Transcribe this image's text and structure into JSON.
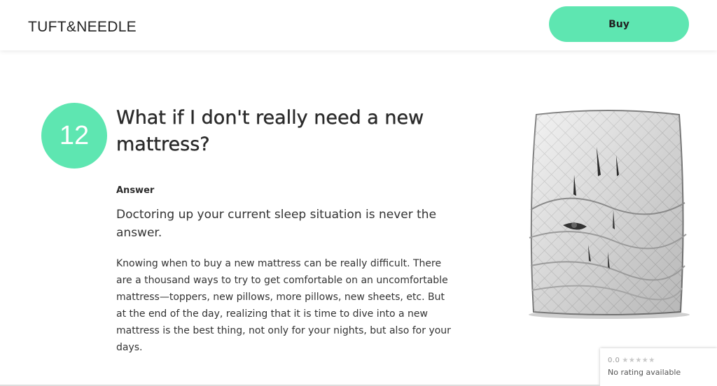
{
  "header": {
    "logo": "TUFT&NEEDLE",
    "buy_label": "Buy"
  },
  "faq": {
    "number": "12",
    "question": "What if I don't really need a new mattress?",
    "answer_label": "Answer",
    "answer_lead": "Doctoring up your current sleep situation is never the answer.",
    "answer_body": "Knowing when to buy a new mattress can be really difficult. There are a thousand ways to try to get comfortable on an uncomfortable mattress—toppers, new pillows, more pillows, new sheets, etc. But at the end of the day, realizing that it is time to dive into a new mattress is the best thing, not only for your nights, but also for your days."
  },
  "rating": {
    "score": "0.0",
    "stars": "★★★★★",
    "text": "No rating available"
  },
  "colors": {
    "accent": "#5ee6b1",
    "text": "#2b2b2b"
  }
}
